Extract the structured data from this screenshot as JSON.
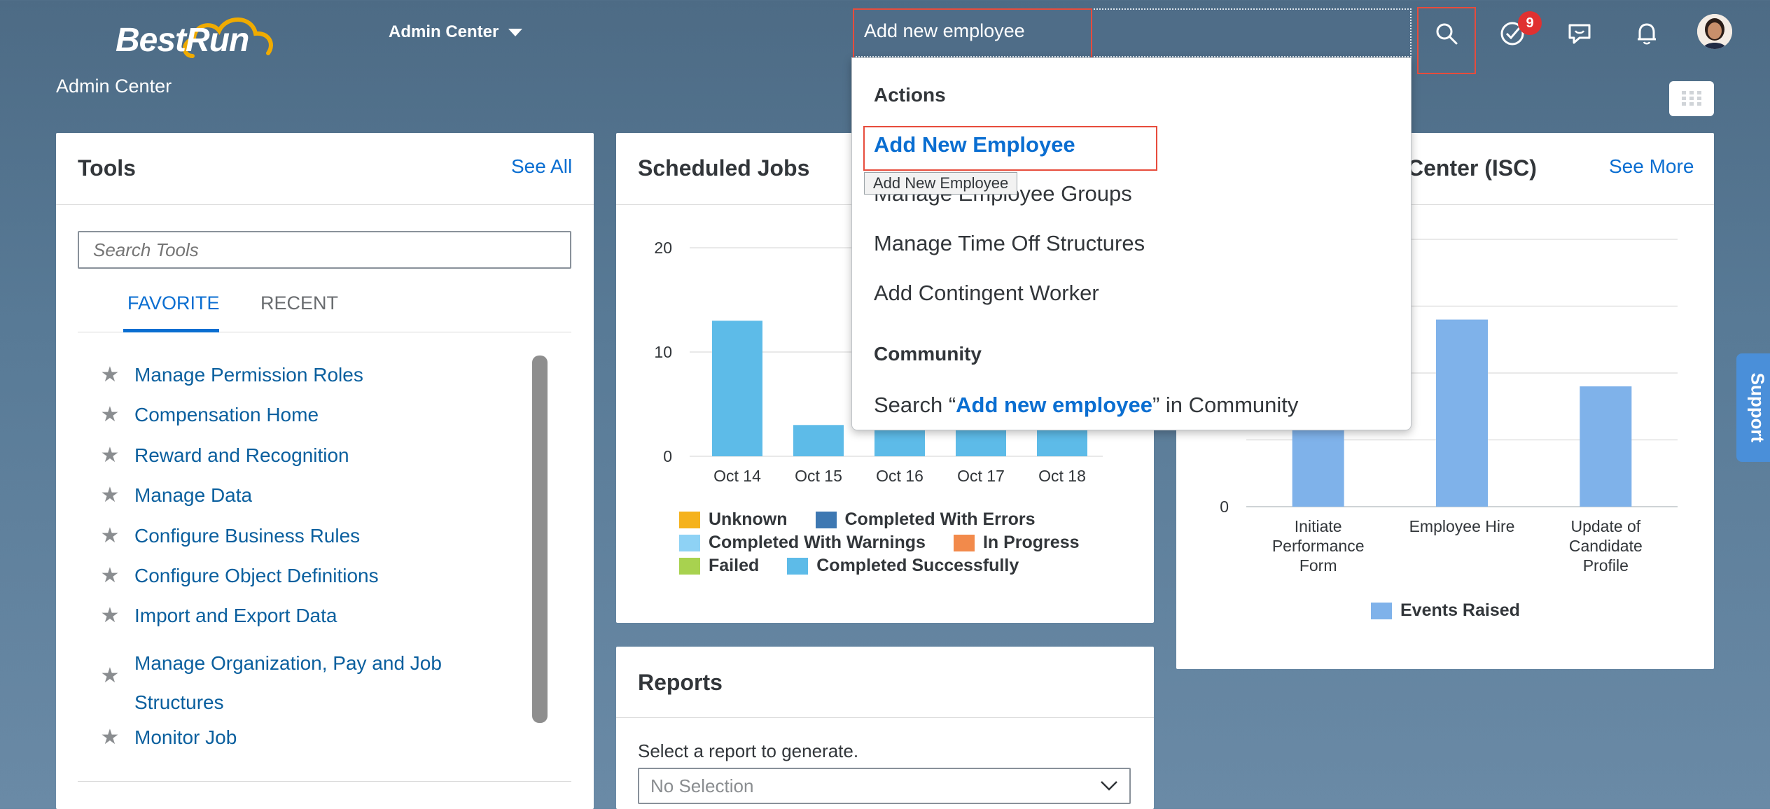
{
  "header": {
    "logo_text": "BestRun",
    "center_title": "Admin Center",
    "admin_menu": "Admin Center",
    "search_value": "Add new employee",
    "notification_count": "9"
  },
  "tools": {
    "title": "Tools",
    "see_all": "See All",
    "search_placeholder": "Search Tools",
    "tabs": [
      "FAVORITE",
      "RECENT"
    ],
    "items": [
      "Manage Permission Roles",
      "Compensation Home",
      "Reward and Recognition",
      "Manage Data",
      "Configure Business Rules",
      "Configure Object Definitions",
      "Import and Export Data",
      "Manage Organization, Pay and Job",
      "Structures",
      "Monitor Job"
    ]
  },
  "scheduled_jobs": {
    "title": "Scheduled Jobs",
    "legend": [
      "Unknown",
      "Completed With Errors",
      "Completed With Warnings",
      "In Progress",
      "Failed",
      "Completed Successfully"
    ]
  },
  "isc": {
    "title_partial": "Center (ISC)",
    "see_more": "See More",
    "legend": "Events Raised"
  },
  "reports": {
    "title": "Reports",
    "prompt": "Select a report to generate.",
    "select_value": "No Selection"
  },
  "dropdown": {
    "actions_header": "Actions",
    "items": [
      "Add New Employee",
      "Manage Employee Groups",
      "Manage Time Off Structures",
      "Add Contingent Worker"
    ],
    "tooltip": "Add New Employee",
    "community_header": "Community",
    "community_prefix": "Search “",
    "community_query": "Add new employee",
    "community_suffix": "” in Community"
  },
  "support": "Support",
  "colors": {
    "jobs_bar": "#5dbbe8",
    "isc_bar": "#7fb2ea",
    "unknown": "#f5b21c",
    "completed_with_errors": "#3e78b2",
    "completed_with_warnings": "#8ed2f5",
    "in_progress": "#f28a4b",
    "failed": "#a8d24f",
    "completed_successfully": "#5dbbe8"
  },
  "chart_data": [
    {
      "type": "bar",
      "title": "Scheduled Jobs",
      "categories": [
        "Oct 14",
        "Oct 15",
        "Oct 16",
        "Oct 17",
        "Oct 18"
      ],
      "series": [
        {
          "name": "Completed Successfully",
          "values": [
            13,
            3,
            3,
            3,
            3
          ]
        }
      ],
      "yticks": [
        "0",
        "10",
        "20"
      ],
      "ylim": [
        0,
        20
      ]
    },
    {
      "type": "bar",
      "title": "Center (ISC)",
      "categories": [
        "Initiate Performance Form",
        "Employee Hire",
        "Update of Candidate Profile"
      ],
      "category_lines": [
        [
          "Initiate",
          "Performance",
          "Form"
        ],
        [
          "Employee Hire"
        ],
        [
          "Update of",
          "Candidate",
          "Profile"
        ]
      ],
      "series": [
        {
          "name": "Events Raised",
          "values": [
            4,
            7,
            4.5
          ]
        }
      ],
      "yticks": [
        "0"
      ],
      "ylim": [
        0,
        10
      ]
    }
  ]
}
